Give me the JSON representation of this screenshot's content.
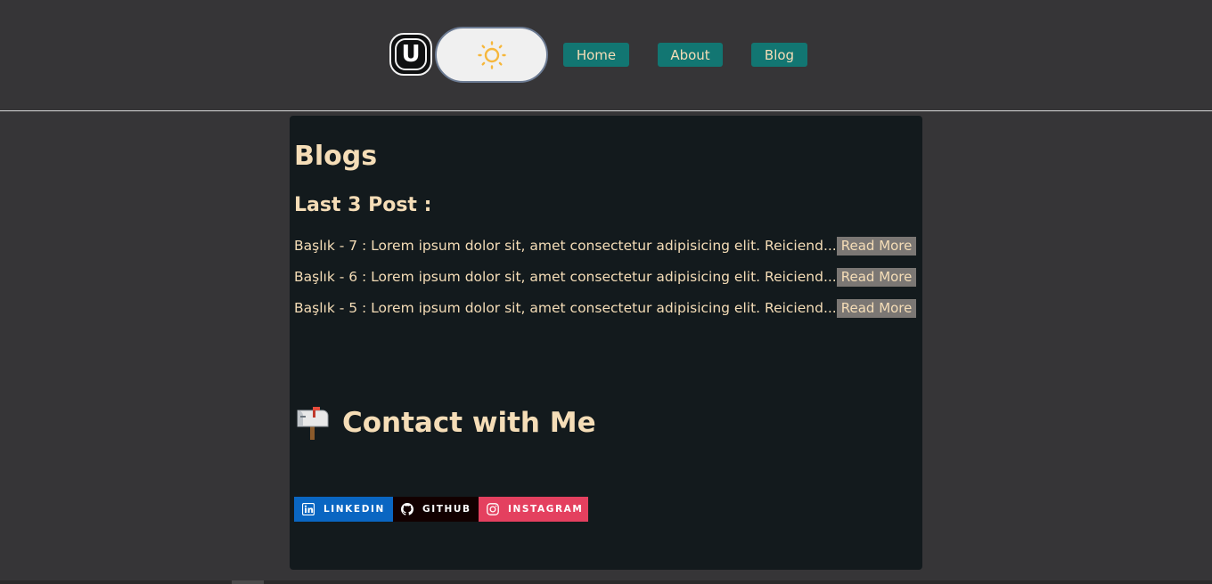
{
  "header": {
    "logo_letter": "U",
    "nav": [
      {
        "label": "Home"
      },
      {
        "label": "About"
      },
      {
        "label": "Blog"
      }
    ]
  },
  "colors": {
    "page_bg": "#363537",
    "content_bg": "#131a1d",
    "accent_text": "#f5ddb7",
    "nav_bg": "#127672",
    "linkedin": "#0a66c2",
    "github": "#120000",
    "instagram": "#e4405f",
    "sun": "#f6b73c"
  },
  "main": {
    "title": "Blogs",
    "subtitle": "Last 3 Post :",
    "posts": [
      {
        "text": "Başlık - 7 : Lorem ipsum dolor sit, amet consectetur adipisicing elit. Reiciend...",
        "action": "Read More"
      },
      {
        "text": "Başlık - 6 : Lorem ipsum dolor sit, amet consectetur adipisicing elit. Reiciend...",
        "action": "Read More"
      },
      {
        "text": "Başlık - 5 : Lorem ipsum dolor sit, amet consectetur adipisicing elit. Reiciend...",
        "action": "Read More"
      }
    ],
    "contact_title": "Contact with Me",
    "socials": [
      {
        "label": "LINKEDIN",
        "icon": "linkedin-icon"
      },
      {
        "label": "GITHUB",
        "icon": "github-icon"
      },
      {
        "label": "INSTAGRAM",
        "icon": "instagram-icon"
      }
    ]
  }
}
